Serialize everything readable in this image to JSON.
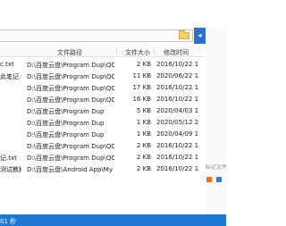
{
  "columns": {
    "path": "文件路径",
    "size": "文件大小",
    "modified": "修改时间"
  },
  "rows": [
    {
      "name": "c.txt",
      "path": "D:\\百度云盘\\Program Dup\\QQDu",
      "size": "2 KB",
      "modified": "2016/10/22 1"
    },
    {
      "name": "此笔记.txt",
      "path": "D:\\百度云盘\\Program Dup\\QQDu",
      "size": "11 KB",
      "modified": "2020/06/22 1"
    },
    {
      "name": "",
      "path": "D:\\百度云盘\\Program Dup\\QQDu",
      "size": "17 KB",
      "modified": "2016/10/22 1"
    },
    {
      "name": "",
      "path": "D:\\百度云盘\\Program Dup\\QQDu",
      "size": "16 KB",
      "modified": "2016/10/22 1"
    },
    {
      "name": "",
      "path": "D:\\百度云盘\\Program Dup",
      "size": "5 KB",
      "modified": "2020/04/03 1"
    },
    {
      "name": "",
      "path": "D:\\百度云盘\\Program Dup",
      "size": "1 KB",
      "modified": "2020/05/12 2"
    },
    {
      "name": "",
      "path": "D:\\百度云盘\\Program Dup",
      "size": "1 KB",
      "modified": "2020/04/09 1"
    },
    {
      "name": "",
      "path": "D:\\百度云盘\\Program Dup\\QQDu",
      "size": "2 KB",
      "modified": "2016/10/22 1"
    },
    {
      "name": "记.txt",
      "path": "D:\\百度云盘\\Program Dup\\QQDu",
      "size": "2 KB",
      "modified": "2016/10/22 1"
    },
    {
      "name": "测试教程...",
      "path": "D:\\百度云盘\\Android App\\My An",
      "size": "2 KB",
      "modified": "2016/10/22 1"
    }
  ],
  "sidebar": {
    "label": "标记文件"
  },
  "status": {
    "text": "01 秒"
  },
  "colors": {
    "accent": "#1e78d3",
    "button": "#2d6fd0"
  }
}
